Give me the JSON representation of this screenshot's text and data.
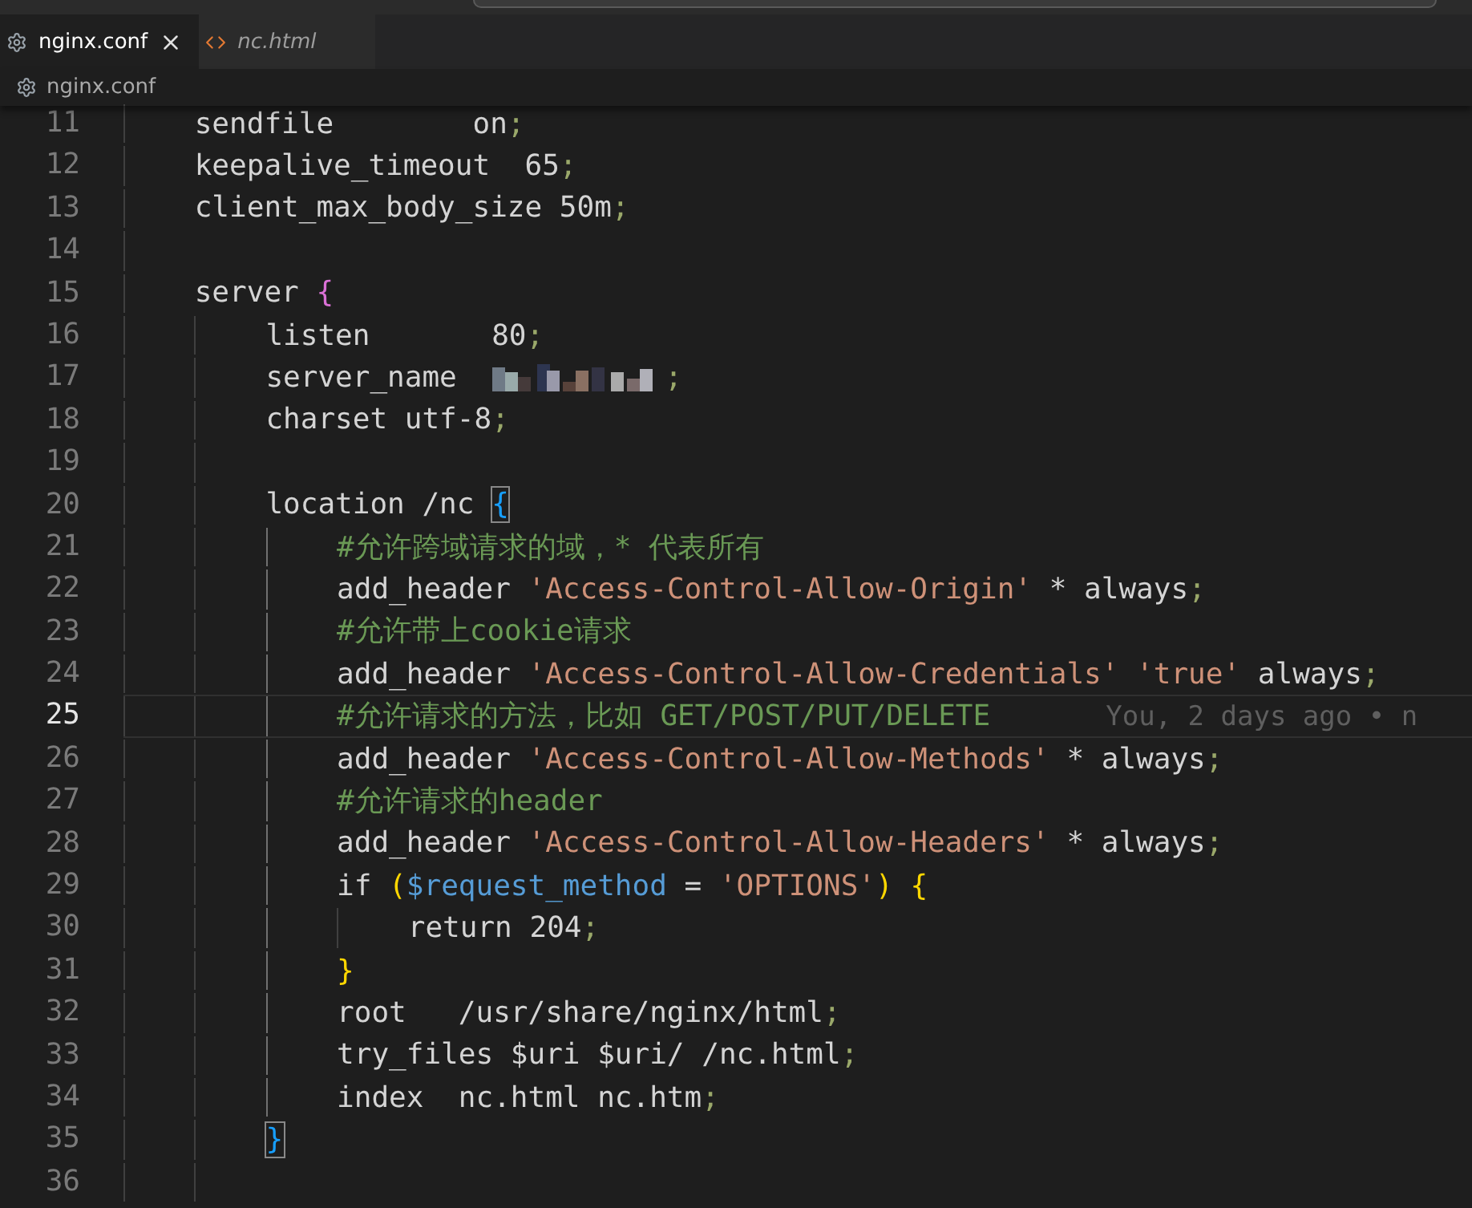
{
  "tabs": [
    {
      "label": "nginx.conf",
      "kind": "config",
      "selected": true,
      "preview": false,
      "closable": true
    },
    {
      "label": "nc.html",
      "kind": "html",
      "selected": false,
      "preview": true,
      "closable": false
    }
  ],
  "breadcrumb": {
    "label": "nginx.conf",
    "kind": "config"
  },
  "lines": [
    {
      "number": "11",
      "guides": [
        {
          "active": false
        }
      ],
      "tokens": [
        {
          "kind": "plain",
          "text": "sendfile        on"
        },
        {
          "kind": "punct",
          "text": ";"
        }
      ]
    },
    {
      "number": "12",
      "guides": [
        {
          "active": false
        }
      ],
      "tokens": [
        {
          "kind": "plain",
          "text": "keepalive_timeout  65"
        },
        {
          "kind": "punct",
          "text": ";"
        }
      ]
    },
    {
      "number": "13",
      "guides": [
        {
          "active": false
        }
      ],
      "tokens": [
        {
          "kind": "plain",
          "text": "client_max_body_size 50m"
        },
        {
          "kind": "punct",
          "text": ";"
        }
      ]
    },
    {
      "number": "14",
      "guides": [
        {
          "active": false
        }
      ]
    },
    {
      "number": "15",
      "guides": [
        {
          "active": false
        }
      ],
      "tokens": [
        {
          "kind": "plain",
          "text": "server "
        },
        {
          "kind": "brace-pink",
          "text": "{"
        }
      ]
    },
    {
      "number": "16",
      "guides": [
        {
          "active": false
        },
        {
          "active": false
        }
      ],
      "tokens": [
        {
          "kind": "plain",
          "text": "listen       80"
        },
        {
          "kind": "punct",
          "text": ";"
        }
      ]
    },
    {
      "number": "17",
      "guides": [
        {
          "active": false
        },
        {
          "active": false
        }
      ],
      "tokens": [
        {
          "kind": "plain",
          "text": "server_name  "
        },
        {
          "kind": "redacted"
        },
        {
          "kind": "punct",
          "text": ";"
        }
      ]
    },
    {
      "number": "18",
      "guides": [
        {
          "active": false
        },
        {
          "active": false
        }
      ],
      "tokens": [
        {
          "kind": "plain",
          "text": "charset utf-8"
        },
        {
          "kind": "punct",
          "text": ";"
        }
      ]
    },
    {
      "number": "19",
      "guides": [
        {
          "active": false
        },
        {
          "active": false
        }
      ]
    },
    {
      "number": "20",
      "guides": [
        {
          "active": false
        },
        {
          "active": false
        }
      ],
      "tokens": [
        {
          "kind": "plain",
          "text": "location /nc "
        },
        {
          "kind": "brace-blue",
          "text": "{",
          "matched": true
        }
      ]
    },
    {
      "number": "21",
      "guides": [
        {
          "active": false
        },
        {
          "active": false
        },
        {
          "active": true
        }
      ],
      "tokens": [
        {
          "kind": "comment",
          "text": "#允许跨域请求的域，* 代表所有"
        }
      ]
    },
    {
      "number": "22",
      "guides": [
        {
          "active": false
        },
        {
          "active": false
        },
        {
          "active": true
        }
      ],
      "tokens": [
        {
          "kind": "plain",
          "text": "add_header "
        },
        {
          "kind": "string",
          "text": "'Access-Control-Allow-Origin'"
        },
        {
          "kind": "plain",
          "text": " * always"
        },
        {
          "kind": "punct",
          "text": ";"
        }
      ]
    },
    {
      "number": "23",
      "guides": [
        {
          "active": false
        },
        {
          "active": false
        },
        {
          "active": true
        }
      ],
      "tokens": [
        {
          "kind": "comment",
          "text": "#允许带上cookie请求"
        }
      ]
    },
    {
      "number": "24",
      "guides": [
        {
          "active": false
        },
        {
          "active": false
        },
        {
          "active": true
        }
      ],
      "tokens": [
        {
          "kind": "plain",
          "text": "add_header "
        },
        {
          "kind": "string",
          "text": "'Access-Control-Allow-Credentials' "
        },
        {
          "kind": "string",
          "text": "'true'"
        },
        {
          "kind": "plain",
          "text": " always"
        },
        {
          "kind": "punct",
          "text": ";"
        }
      ]
    },
    {
      "number": "25",
      "current": true,
      "blame": "You, 2 days ago • n",
      "guides": [
        {
          "active": false
        },
        {
          "active": false
        },
        {
          "active": true
        }
      ],
      "tokens": [
        {
          "kind": "comment",
          "text": "#允许请求的方法，比如 GET/POST/PUT/DELETE"
        }
      ]
    },
    {
      "number": "26",
      "guides": [
        {
          "active": false
        },
        {
          "active": false
        },
        {
          "active": true
        }
      ],
      "tokens": [
        {
          "kind": "plain",
          "text": "add_header "
        },
        {
          "kind": "string",
          "text": "'Access-Control-Allow-Methods'"
        },
        {
          "kind": "plain",
          "text": " * always"
        },
        {
          "kind": "punct",
          "text": ";"
        }
      ]
    },
    {
      "number": "27",
      "guides": [
        {
          "active": false
        },
        {
          "active": false
        },
        {
          "active": true
        }
      ],
      "tokens": [
        {
          "kind": "comment",
          "text": "#允许请求的header"
        }
      ]
    },
    {
      "number": "28",
      "guides": [
        {
          "active": false
        },
        {
          "active": false
        },
        {
          "active": true
        }
      ],
      "tokens": [
        {
          "kind": "plain",
          "text": "add_header "
        },
        {
          "kind": "string",
          "text": "'Access-Control-Allow-Headers'"
        },
        {
          "kind": "plain",
          "text": " * always"
        },
        {
          "kind": "punct",
          "text": ";"
        }
      ]
    },
    {
      "number": "29",
      "guides": [
        {
          "active": false
        },
        {
          "active": false
        },
        {
          "active": true
        }
      ],
      "tokens": [
        {
          "kind": "plain",
          "text": "if "
        },
        {
          "kind": "brace-gold",
          "text": "("
        },
        {
          "kind": "variable",
          "text": "$request_method"
        },
        {
          "kind": "plain",
          "text": " = "
        },
        {
          "kind": "string",
          "text": "'OPTIONS'"
        },
        {
          "kind": "brace-gold",
          "text": ") "
        },
        {
          "kind": "brace-gold",
          "text": "{"
        }
      ]
    },
    {
      "number": "30",
      "guides": [
        {
          "active": false
        },
        {
          "active": false
        },
        {
          "active": true
        },
        {
          "active": false
        }
      ],
      "tokens": [
        {
          "kind": "plain",
          "text": "return 204"
        },
        {
          "kind": "punct",
          "text": ";"
        }
      ]
    },
    {
      "number": "31",
      "guides": [
        {
          "active": false
        },
        {
          "active": false
        },
        {
          "active": true
        }
      ],
      "tokens": [
        {
          "kind": "brace-gold",
          "text": "}"
        }
      ]
    },
    {
      "number": "32",
      "guides": [
        {
          "active": false
        },
        {
          "active": false
        },
        {
          "active": true
        }
      ],
      "tokens": [
        {
          "kind": "plain",
          "text": "root   /usr/share/nginx/html"
        },
        {
          "kind": "punct",
          "text": ";"
        }
      ]
    },
    {
      "number": "33",
      "guides": [
        {
          "active": false
        },
        {
          "active": false
        },
        {
          "active": true
        }
      ],
      "tokens": [
        {
          "kind": "plain",
          "text": "try_files $uri $uri/ /nc.html"
        },
        {
          "kind": "punct",
          "text": ";"
        }
      ]
    },
    {
      "number": "34",
      "guides": [
        {
          "active": false
        },
        {
          "active": false
        },
        {
          "active": true
        }
      ],
      "tokens": [
        {
          "kind": "plain",
          "text": "index  nc.html nc.htm"
        },
        {
          "kind": "punct",
          "text": ";"
        }
      ]
    },
    {
      "number": "35",
      "guides": [
        {
          "active": false
        },
        {
          "active": false
        }
      ],
      "tokens": [
        {
          "kind": "brace-blue",
          "text": "}",
          "matched": true
        }
      ]
    },
    {
      "number": "36",
      "guides": [
        {
          "active": false
        },
        {
          "active": false
        }
      ]
    }
  ]
}
